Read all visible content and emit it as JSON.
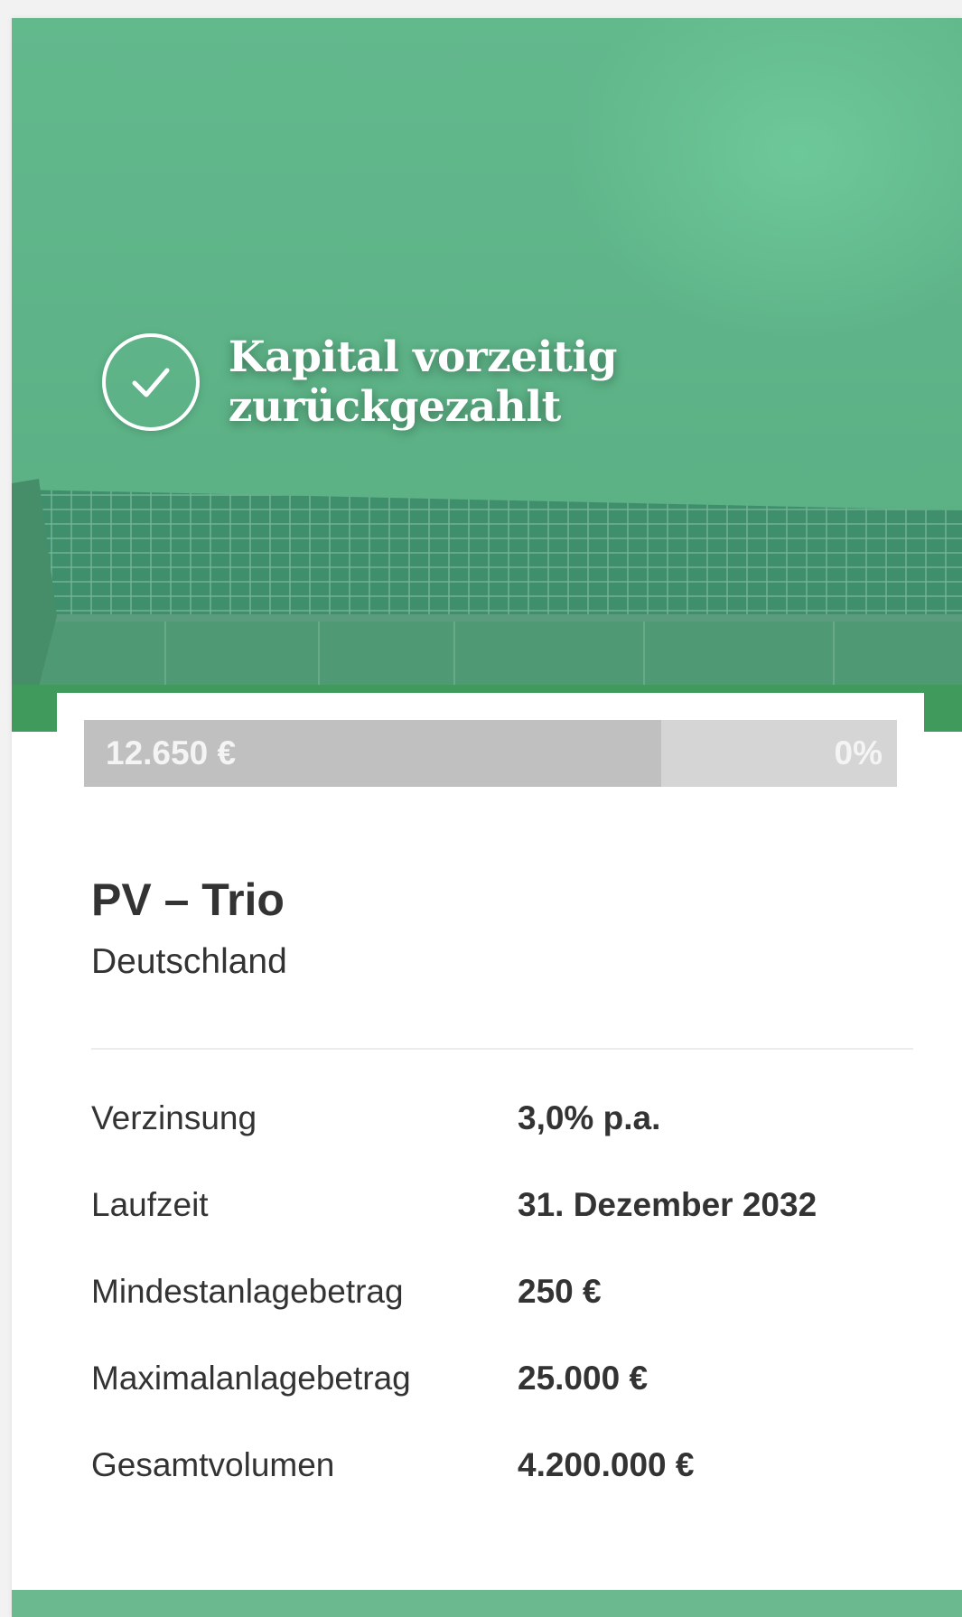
{
  "project": {
    "status": "Kapital vorzeitig zurückgezahlt",
    "status_icon": "check-circle-icon",
    "title": "PV – Trio",
    "location": "Deutschland"
  },
  "progress": {
    "amount": "12.650 €",
    "percent_label": "0%",
    "filled_fraction": 0.71
  },
  "details": [
    {
      "label": "Verzinsung",
      "value": "3,0% p.a."
    },
    {
      "label": "Laufzeit",
      "value": "31. Dezember 2032"
    },
    {
      "label": "Mindestanlagebetrag",
      "value": "250 €"
    },
    {
      "label": "Maximalanlagebetrag",
      "value": "25.000 €"
    },
    {
      "label": "Gesamtvolumen",
      "value": "4.200.000 €"
    }
  ],
  "colors": {
    "brand_green": "#5eb488",
    "progress_track": "#d5d5d5",
    "progress_fill": "#c0c0c0",
    "text": "#333333"
  }
}
